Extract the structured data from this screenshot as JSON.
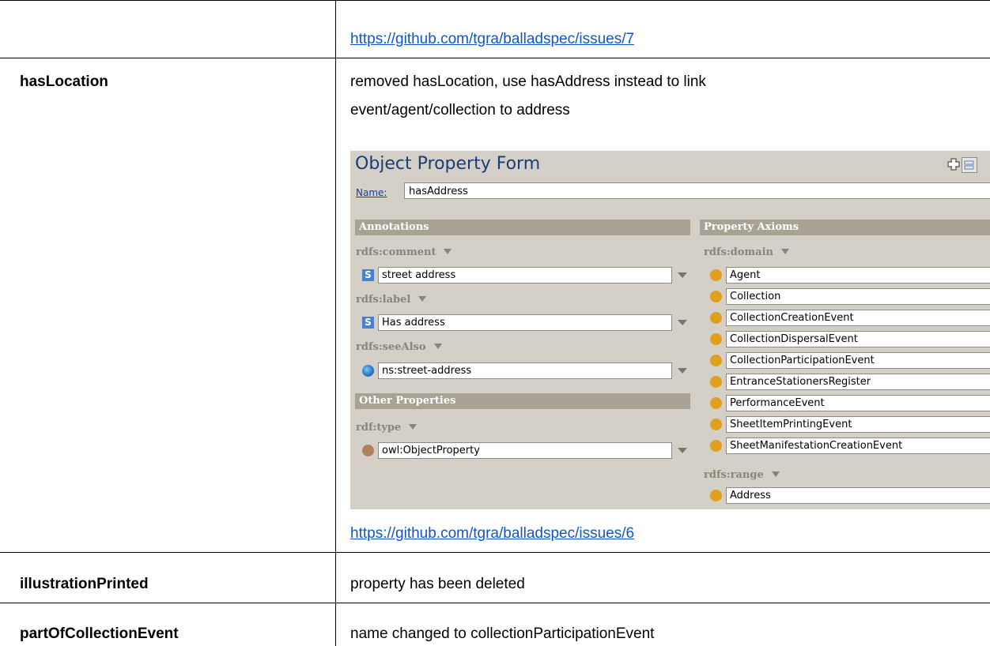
{
  "rows": [
    {
      "name": "",
      "link": "https://github.com/tgra/balladspec/issues/7"
    },
    {
      "name": "hasLocation",
      "text_line1": "removed hasLocation, use hasAddress instead to link",
      "text_line2": "event/agent/collection to address",
      "link": "https://github.com/tgra/balladspec/issues/6"
    },
    {
      "name": "illustrationPrinted",
      "text": "property has been deleted"
    },
    {
      "name": "partOfCollectionEvent",
      "text": "name changed to collectionParticipationEvent"
    }
  ],
  "form": {
    "title": "Object Property Form",
    "name_label": "Name:",
    "name_value": "hasAddress",
    "annotations_header": "Annotations",
    "axioms_header": "Property Axioms",
    "other_header": "Other Properties",
    "comment_label": "rdfs:comment",
    "comment_value": "street address",
    "label_label": "rdfs:label",
    "label_value": "Has address",
    "seealso_label": "rdfs:seeAlso",
    "seealso_value": "ns:street-address",
    "type_label": "rdf:type",
    "type_value": "owl:ObjectProperty",
    "domain_label": "rdfs:domain",
    "domain_items": [
      "Agent",
      "Collection",
      "CollectionCreationEvent",
      "CollectionDispersalEvent",
      "CollectionParticipationEvent",
      "EntranceStationersRegister",
      "PerformanceEvent",
      "SheetItemPrintingEvent",
      "SheetManifestationCreationEvent"
    ],
    "range_label": "rdfs:range",
    "range_value": "Address",
    "string_icon_letter": "S",
    "colors": {
      "header_bg": "#a8a294",
      "panel_bg": "#d4d0c8",
      "class_dot": "#dfa01e",
      "title": "#1a3c78"
    }
  }
}
